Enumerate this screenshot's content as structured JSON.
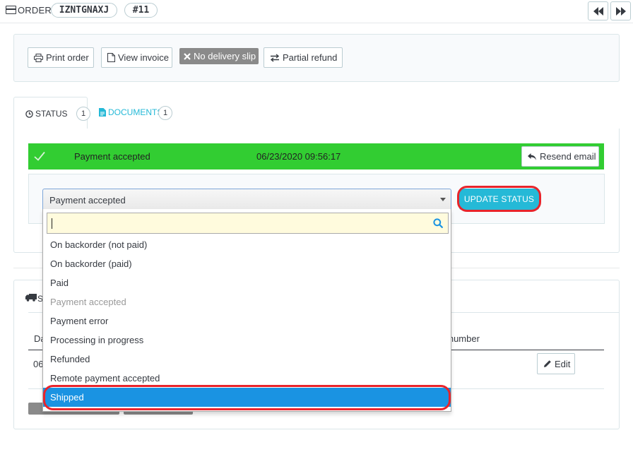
{
  "header": {
    "title": "ORDER",
    "reference": "IZNTGNAXJ",
    "order_number": "#11"
  },
  "actions": {
    "print_order": "Print order",
    "view_invoice": "View invoice",
    "no_delivery_slip": "No delivery slip",
    "partial_refund": "Partial refund"
  },
  "tabs": {
    "status_label": "STATUS",
    "status_count": "1",
    "documents_label": "DOCUMENTS",
    "documents_count": "1"
  },
  "history": {
    "status": "Payment accepted",
    "date": "06/23/2020 09:56:17",
    "resend_label": "Resend email",
    "row_color": "#32cd32"
  },
  "status_select": {
    "selected": "Payment accepted",
    "search_value": "",
    "options": [
      {
        "label": "On backorder (not paid)",
        "state": "normal"
      },
      {
        "label": "On backorder (paid)",
        "state": "normal"
      },
      {
        "label": "Paid",
        "state": "normal"
      },
      {
        "label": "Payment accepted",
        "state": "disabled"
      },
      {
        "label": "Payment error",
        "state": "normal"
      },
      {
        "label": "Processing in progress",
        "state": "normal"
      },
      {
        "label": "Refunded",
        "state": "normal"
      },
      {
        "label": "Remote payment accepted",
        "state": "normal"
      },
      {
        "label": "Shipped",
        "state": "highlighted"
      }
    ]
  },
  "update_button": "UPDATE STATUS",
  "shipping": {
    "title_fragment": "Sh",
    "col_date_fragment": "Da",
    "col_tracking_fragment": "g number",
    "cell_date_fragment": "06",
    "edit_label": "Edit"
  },
  "colors": {
    "accent": "#25b9d7",
    "highlight": "#1a93e2",
    "annotation_red": "#e8242b"
  }
}
